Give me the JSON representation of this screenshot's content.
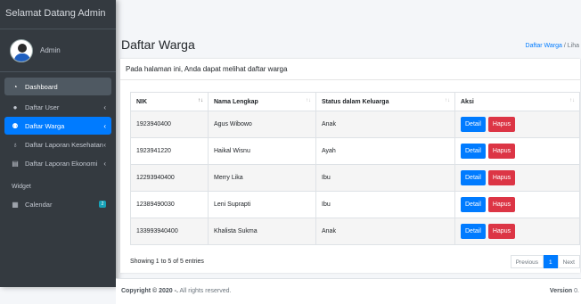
{
  "sidebar": {
    "brand": "Selamat Datang Admin",
    "user": "Admin",
    "items": [
      {
        "label": "Dashboard",
        "icon": "gauge-icon"
      },
      {
        "label": "Daftar User",
        "icon": "user-icon"
      },
      {
        "label": "Daftar Warga",
        "icon": "users-icon"
      },
      {
        "label": "Daftar Laporan Kesehatan",
        "icon": "stethoscope-icon"
      },
      {
        "label": "Daftar Laporan Ekonomi",
        "icon": "book-icon"
      }
    ],
    "header": "Widget",
    "calendar": {
      "label": "Calendar",
      "badge": "2"
    }
  },
  "page": {
    "title": "Daftar Warga",
    "breadcrumb": {
      "link": "Daftar Warga",
      "separator": "/",
      "current": "Liha"
    }
  },
  "card": {
    "description": "Pada halaman ini, Anda dapat melihat daftar warga"
  },
  "table": {
    "headers": [
      "NIK",
      "Nama Lengkap",
      "Status dalam Keluarga",
      "Aksi"
    ],
    "rows": [
      {
        "nik": "1923940400",
        "nama": "Agus Wibowo",
        "status": "Anak"
      },
      {
        "nik": "1923941220",
        "nama": "Haikal Wisnu",
        "status": "Ayah"
      },
      {
        "nik": "12293940400",
        "nama": "Merry Lika",
        "status": "Ibu"
      },
      {
        "nik": "12389490030",
        "nama": "Leni Suprapti",
        "status": "Ibu"
      },
      {
        "nik": "133993940400",
        "nama": "Khalista Sukma",
        "status": "Anak"
      }
    ],
    "detail_label": "Detail",
    "hapus_label": "Hapus",
    "info": "Showing 1 to 5 of 5 entries",
    "pagination": {
      "previous": "Previous",
      "page": "1",
      "next": "Next"
    }
  },
  "footer": {
    "copyright": "Copyright © 2020 -.",
    "rights": " All rights reserved.",
    "version_label": "Version",
    "version_value": " 0."
  },
  "colors": {
    "primary": "#007bff",
    "danger": "#dc3545",
    "sidebar": "#343a40"
  }
}
